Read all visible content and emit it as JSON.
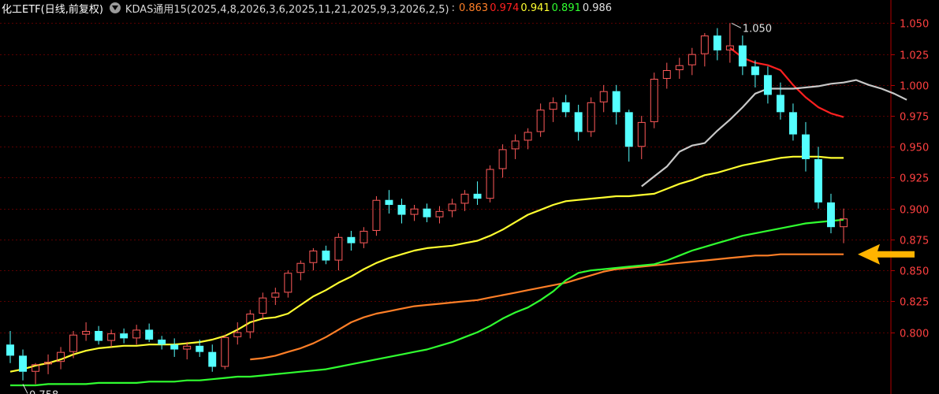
{
  "header": {
    "title": "化工ETF(日线,前复权)",
    "indicator_name": "KDAS通用15(2025,4,8,2026,3,6,2025,11,21,2025,9,3,2026,2,5)",
    "values": [
      {
        "text": "0.863",
        "color": "#ff7f27"
      },
      {
        "text": "0.974",
        "color": "#ff2020"
      },
      {
        "text": "0.941",
        "color": "#ffff30"
      },
      {
        "text": "0.891",
        "color": "#30ff30"
      },
      {
        "text": "0.986",
        "color": "#e0e0e0"
      }
    ]
  },
  "chart_data": {
    "type": "candlestick",
    "ylim": [
      0.757,
      1.056
    ],
    "y_ticks": [
      "1.050",
      "1.025",
      "1.000",
      "0.975",
      "0.950",
      "0.925",
      "0.900",
      "0.875",
      "0.850",
      "0.825",
      "0.800"
    ],
    "grid": "horizontal dashed",
    "colors": {
      "up": "#ff5a5a",
      "down": "#54ffff",
      "tick_text": "#ff4040",
      "grid": "#5a0000",
      "axis": "#b00000"
    },
    "annotations": [
      {
        "text": "1.050",
        "type": "high",
        "index": 57,
        "value": 1.05
      },
      {
        "text": "0.758",
        "type": "low",
        "index": 1,
        "value": 0.758
      }
    ],
    "arrow": {
      "value": 0.863,
      "color": "#ffb400",
      "direction": "left"
    },
    "candles": [
      [
        0.79,
        0.801,
        0.775,
        0.781
      ],
      [
        0.781,
        0.786,
        0.761,
        0.768
      ],
      [
        0.768,
        0.775,
        0.758,
        0.774
      ],
      [
        0.774,
        0.782,
        0.766,
        0.776
      ],
      [
        0.776,
        0.788,
        0.77,
        0.784
      ],
      [
        0.784,
        0.801,
        0.779,
        0.798
      ],
      [
        0.798,
        0.808,
        0.793,
        0.801
      ],
      [
        0.801,
        0.805,
        0.79,
        0.793
      ],
      [
        0.793,
        0.802,
        0.788,
        0.799
      ],
      [
        0.799,
        0.803,
        0.791,
        0.795
      ],
      [
        0.795,
        0.806,
        0.79,
        0.802
      ],
      [
        0.802,
        0.807,
        0.792,
        0.794
      ],
      [
        0.794,
        0.797,
        0.786,
        0.79
      ],
      [
        0.79,
        0.795,
        0.78,
        0.786
      ],
      [
        0.786,
        0.792,
        0.778,
        0.789
      ],
      [
        0.789,
        0.794,
        0.78,
        0.784
      ],
      [
        0.784,
        0.79,
        0.768,
        0.772
      ],
      [
        0.772,
        0.798,
        0.77,
        0.796
      ],
      [
        0.796,
        0.808,
        0.79,
        0.8
      ],
      [
        0.8,
        0.818,
        0.795,
        0.815
      ],
      [
        0.815,
        0.832,
        0.81,
        0.828
      ],
      [
        0.828,
        0.836,
        0.822,
        0.832
      ],
      [
        0.832,
        0.85,
        0.828,
        0.848
      ],
      [
        0.848,
        0.858,
        0.842,
        0.856
      ],
      [
        0.856,
        0.868,
        0.85,
        0.866
      ],
      [
        0.866,
        0.87,
        0.855,
        0.858
      ],
      [
        0.858,
        0.88,
        0.85,
        0.877
      ],
      [
        0.877,
        0.882,
        0.866,
        0.872
      ],
      [
        0.872,
        0.885,
        0.868,
        0.882
      ],
      [
        0.882,
        0.91,
        0.878,
        0.907
      ],
      [
        0.907,
        0.915,
        0.896,
        0.903
      ],
      [
        0.903,
        0.908,
        0.888,
        0.895
      ],
      [
        0.895,
        0.903,
        0.89,
        0.9
      ],
      [
        0.9,
        0.904,
        0.889,
        0.893
      ],
      [
        0.893,
        0.902,
        0.888,
        0.898
      ],
      [
        0.898,
        0.908,
        0.893,
        0.904
      ],
      [
        0.904,
        0.915,
        0.898,
        0.912
      ],
      [
        0.912,
        0.922,
        0.903,
        0.908
      ],
      [
        0.908,
        0.935,
        0.905,
        0.932
      ],
      [
        0.932,
        0.952,
        0.925,
        0.948
      ],
      [
        0.948,
        0.96,
        0.94,
        0.955
      ],
      [
        0.955,
        0.965,
        0.948,
        0.962
      ],
      [
        0.962,
        0.985,
        0.958,
        0.98
      ],
      [
        0.98,
        0.99,
        0.97,
        0.986
      ],
      [
        0.986,
        0.992,
        0.974,
        0.978
      ],
      [
        0.978,
        0.984,
        0.955,
        0.962
      ],
      [
        0.962,
        0.99,
        0.958,
        0.986
      ],
      [
        0.986,
        1.0,
        0.978,
        0.995
      ],
      [
        0.995,
        1.0,
        0.968,
        0.978
      ],
      [
        0.978,
        0.98,
        0.938,
        0.95
      ],
      [
        0.95,
        0.975,
        0.94,
        0.97
      ],
      [
        0.97,
        1.01,
        0.965,
        1.005
      ],
      [
        1.005,
        1.018,
        0.997,
        1.012
      ],
      [
        1.012,
        1.022,
        1.005,
        1.016
      ],
      [
        1.016,
        1.03,
        1.008,
        1.025
      ],
      [
        1.025,
        1.042,
        1.015,
        1.04
      ],
      [
        1.04,
        1.046,
        1.02,
        1.028
      ],
      [
        1.028,
        1.05,
        1.018,
        1.032
      ],
      [
        1.032,
        1.04,
        1.008,
        1.015
      ],
      [
        1.015,
        1.02,
        0.998,
        1.008
      ],
      [
        1.008,
        1.015,
        0.985,
        0.992
      ],
      [
        0.992,
        1.002,
        0.972,
        0.978
      ],
      [
        0.978,
        0.985,
        0.955,
        0.96
      ],
      [
        0.96,
        0.97,
        0.93,
        0.94
      ],
      [
        0.94,
        0.95,
        0.9,
        0.905
      ],
      [
        0.905,
        0.912,
        0.88,
        0.885
      ],
      [
        0.885,
        0.9,
        0.872,
        0.892
      ]
    ],
    "series": [
      {
        "name": "0.863",
        "color": "#ff7f27",
        "start": 19,
        "values": [
          0.778,
          0.779,
          0.781,
          0.784,
          0.787,
          0.791,
          0.796,
          0.802,
          0.808,
          0.812,
          0.815,
          0.817,
          0.819,
          0.821,
          0.822,
          0.823,
          0.824,
          0.825,
          0.826,
          0.828,
          0.83,
          0.832,
          0.834,
          0.836,
          0.838,
          0.84,
          0.843,
          0.846,
          0.849,
          0.851,
          0.852,
          0.853,
          0.854,
          0.855,
          0.856,
          0.857,
          0.858,
          0.859,
          0.86,
          0.861,
          0.862,
          0.862,
          0.863,
          0.863,
          0.863,
          0.863,
          0.863,
          0.863
        ]
      },
      {
        "name": "0.974",
        "color": "#ff2020",
        "start": 57,
        "values": [
          1.03,
          1.022,
          1.018,
          1.016,
          1.012,
          1.0,
          0.99,
          0.982,
          0.977,
          0.974
        ]
      },
      {
        "name": "0.941",
        "color": "#ffff30",
        "start": 0,
        "values": [
          0.768,
          0.77,
          0.773,
          0.775,
          0.778,
          0.782,
          0.785,
          0.787,
          0.788,
          0.789,
          0.789,
          0.79,
          0.79,
          0.79,
          0.791,
          0.792,
          0.794,
          0.797,
          0.802,
          0.808,
          0.811,
          0.812,
          0.815,
          0.822,
          0.829,
          0.834,
          0.84,
          0.845,
          0.851,
          0.856,
          0.86,
          0.863,
          0.866,
          0.868,
          0.869,
          0.87,
          0.872,
          0.874,
          0.878,
          0.883,
          0.889,
          0.895,
          0.899,
          0.903,
          0.906,
          0.907,
          0.908,
          0.909,
          0.91,
          0.91,
          0.911,
          0.912,
          0.916,
          0.92,
          0.923,
          0.927,
          0.929,
          0.932,
          0.935,
          0.937,
          0.939,
          0.941,
          0.942,
          0.942,
          0.942,
          0.941,
          0.941
        ]
      },
      {
        "name": "0.891",
        "color": "#30ff30",
        "start": 0,
        "values": [
          0.757,
          0.757,
          0.757,
          0.758,
          0.758,
          0.758,
          0.758,
          0.759,
          0.759,
          0.759,
          0.759,
          0.76,
          0.76,
          0.76,
          0.761,
          0.761,
          0.762,
          0.763,
          0.764,
          0.764,
          0.765,
          0.766,
          0.767,
          0.768,
          0.769,
          0.77,
          0.772,
          0.774,
          0.776,
          0.778,
          0.78,
          0.782,
          0.784,
          0.786,
          0.789,
          0.792,
          0.796,
          0.8,
          0.805,
          0.811,
          0.816,
          0.82,
          0.826,
          0.833,
          0.842,
          0.848,
          0.85,
          0.851,
          0.852,
          0.853,
          0.854,
          0.855,
          0.858,
          0.862,
          0.866,
          0.869,
          0.872,
          0.875,
          0.878,
          0.88,
          0.882,
          0.884,
          0.886,
          0.888,
          0.889,
          0.89,
          0.891
        ]
      },
      {
        "name": "0.986",
        "color": "#c8c8c8",
        "start": 50,
        "values": [
          0.918,
          0.926,
          0.934,
          0.946,
          0.951,
          0.953,
          0.963,
          0.972,
          0.982,
          0.993,
          0.997,
          0.997,
          0.997,
          0.998,
          0.999,
          1.001,
          1.002,
          1.004,
          1.0,
          0.997,
          0.993,
          0.988
        ]
      }
    ]
  }
}
